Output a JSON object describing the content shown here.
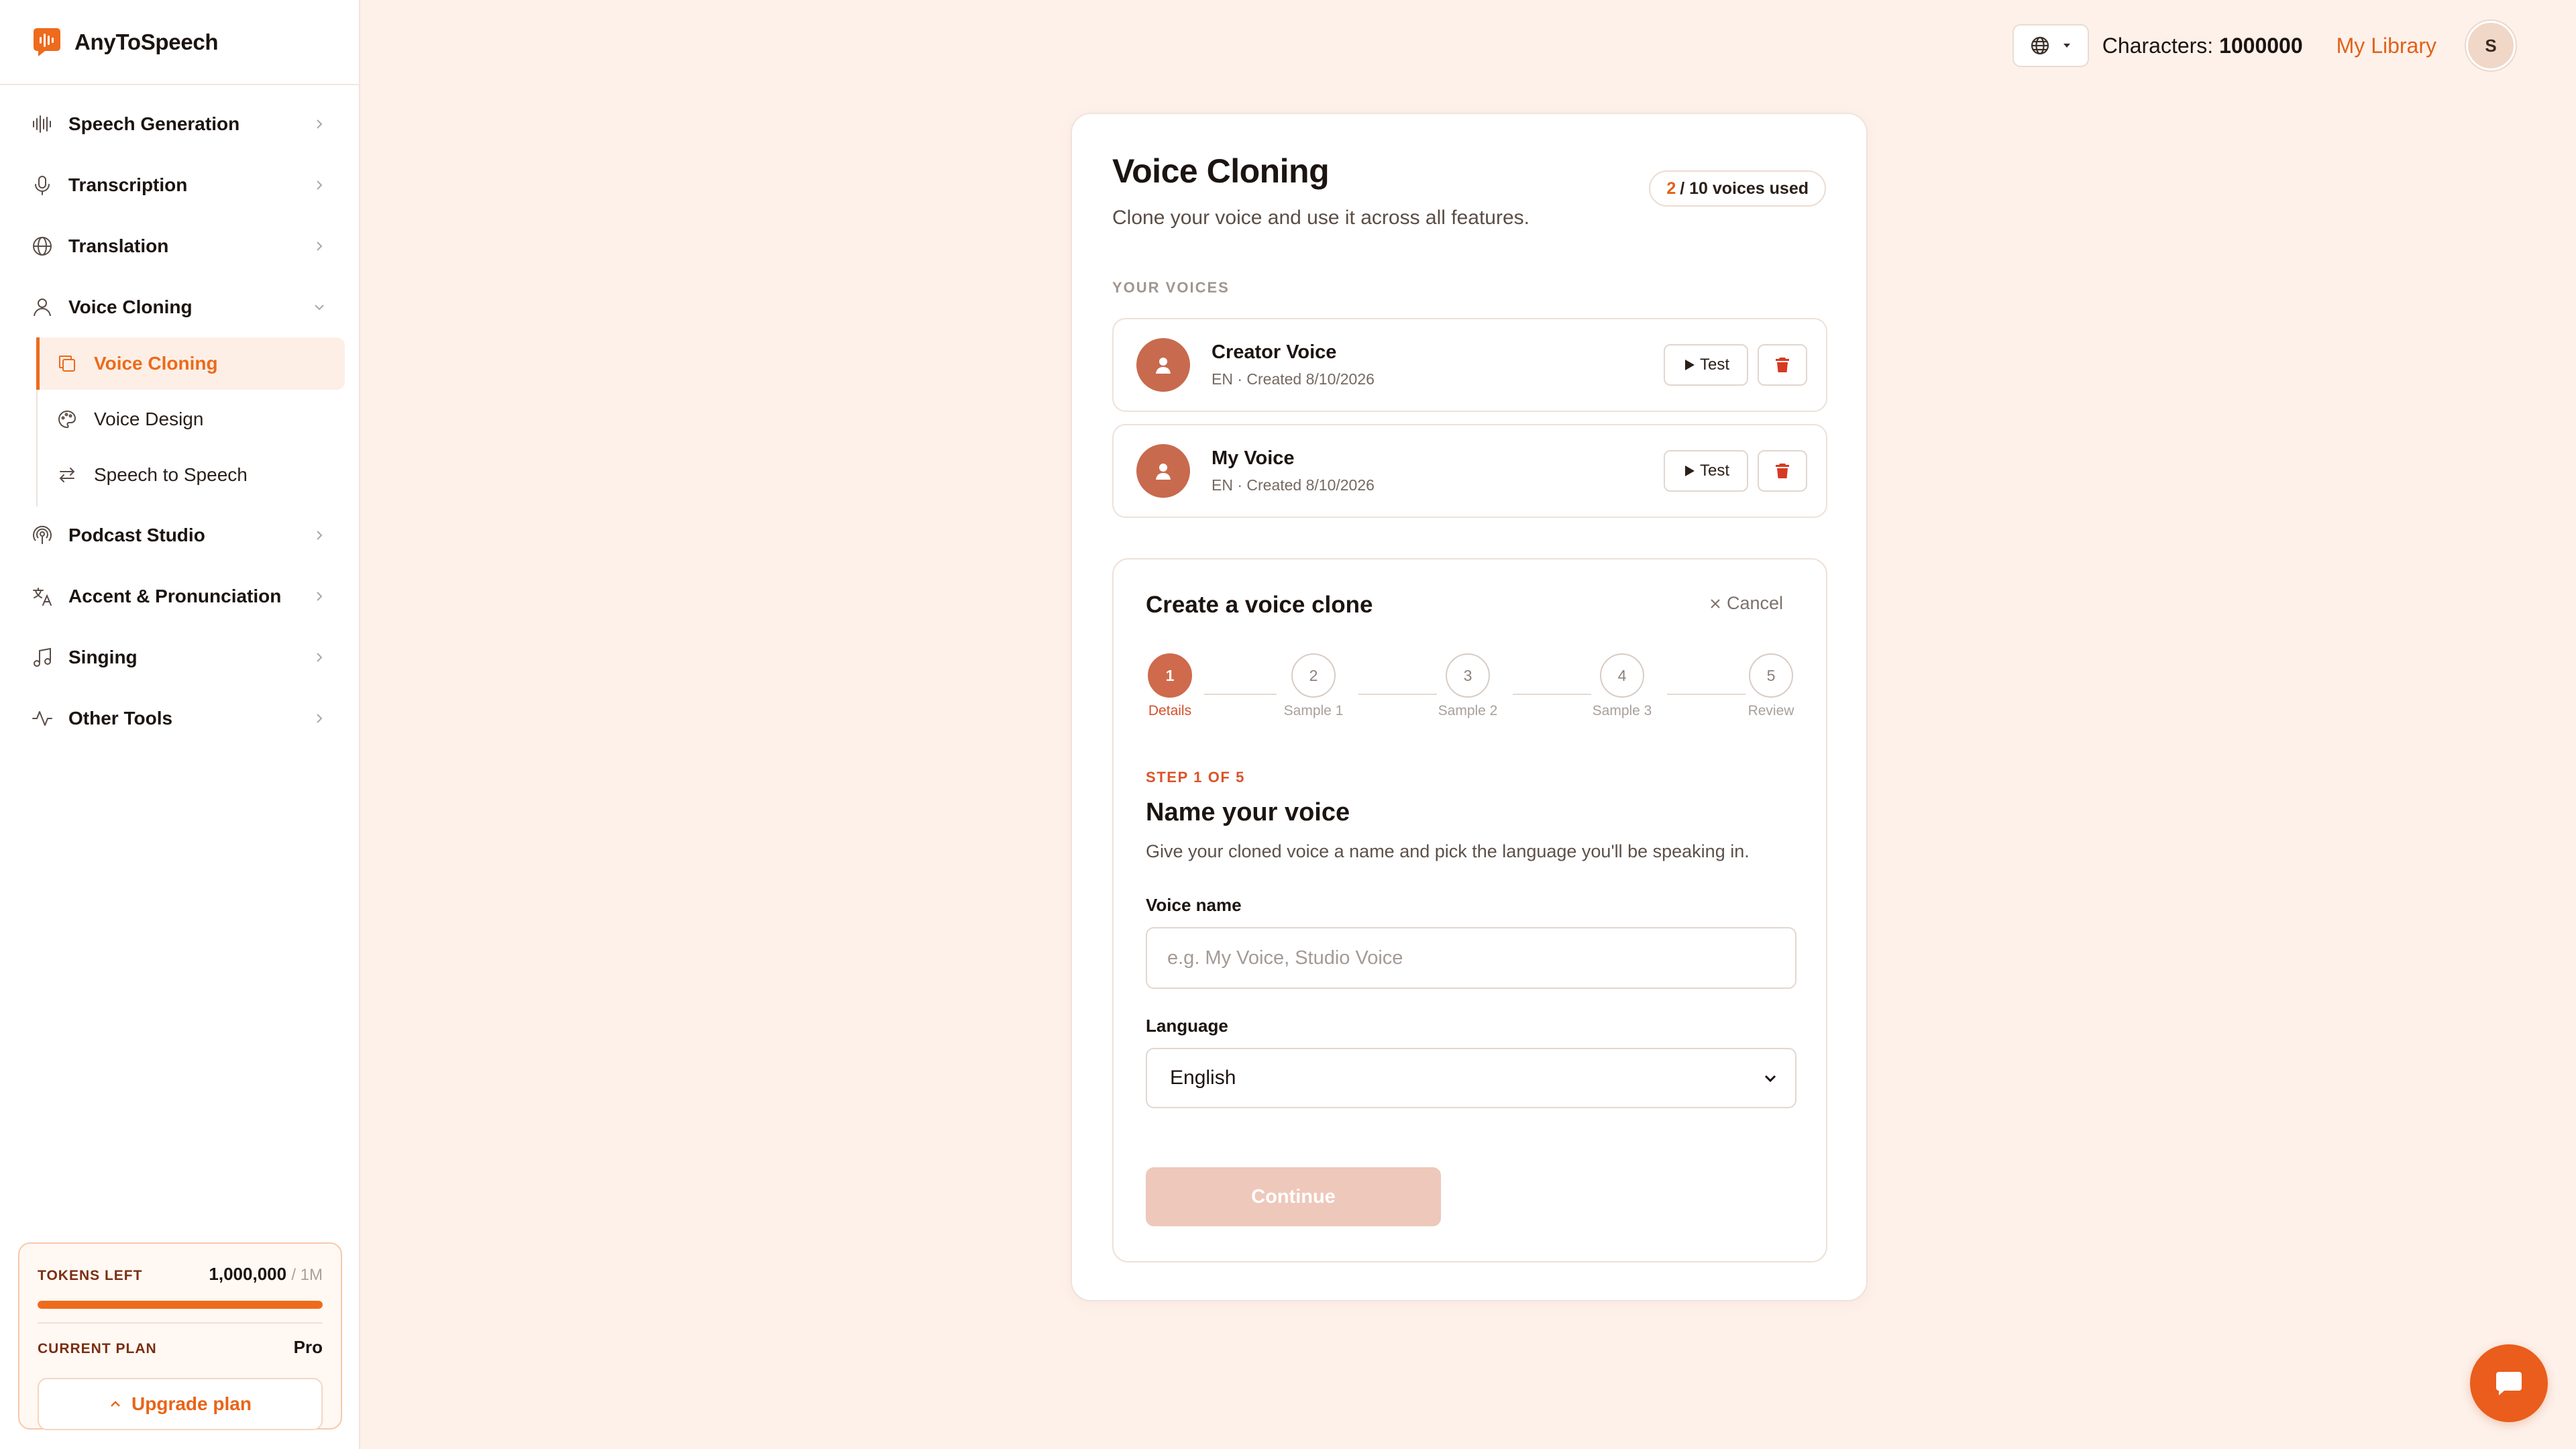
{
  "brand": {
    "name": "AnyToSpeech",
    "accent": "#ee6a1d"
  },
  "nav": {
    "items": [
      {
        "label": "Speech Generation",
        "icon": "waveform-icon"
      },
      {
        "label": "Transcription",
        "icon": "microphone-icon"
      },
      {
        "label": "Translation",
        "icon": "globe-icon"
      },
      {
        "label": "Voice Cloning",
        "icon": "user-icon",
        "expanded": true
      },
      {
        "label": "Podcast Studio",
        "icon": "podcast-icon"
      },
      {
        "label": "Accent & Pronunciation",
        "icon": "language-icon"
      },
      {
        "label": "Singing",
        "icon": "music-note-icon"
      },
      {
        "label": "Other Tools",
        "icon": "activity-icon"
      }
    ],
    "voice_cloning_sub": [
      {
        "label": "Voice Cloning",
        "icon": "copy-icon",
        "active": true
      },
      {
        "label": "Voice Design",
        "icon": "palette-icon"
      },
      {
        "label": "Speech to Speech",
        "icon": "swap-arrows-icon"
      }
    ]
  },
  "plan": {
    "tokens_label": "TOKENS LEFT",
    "tokens_value": "1,000,000",
    "tokens_total": "/ 1M",
    "tokens_fraction": 1.0,
    "current_plan_label": "CURRENT PLAN",
    "current_plan_value": "Pro",
    "upgrade_label": "Upgrade plan"
  },
  "topbar": {
    "characters_label": "Characters:",
    "characters_value": "1000000",
    "my_library": "My Library",
    "avatar_initial": "S"
  },
  "page": {
    "title": "Voice Cloning",
    "subtitle": "Clone your voice and use it across all features.",
    "usage_used": "2",
    "usage_rest": "/ 10 voices used",
    "your_voices_label": "YOUR VOICES"
  },
  "voices": [
    {
      "name": "Creator Voice",
      "meta": "EN · Created 8/10/2026",
      "test_label": "Test"
    },
    {
      "name": "My Voice",
      "meta": "EN · Created 8/10/2026",
      "test_label": "Test"
    }
  ],
  "clone": {
    "title": "Create a voice clone",
    "cancel_label": "Cancel",
    "steps": [
      {
        "number": "1",
        "label": "Details",
        "active": true
      },
      {
        "number": "2",
        "label": "Sample 1"
      },
      {
        "number": "3",
        "label": "Sample 2"
      },
      {
        "number": "4",
        "label": "Sample 3"
      },
      {
        "number": "5",
        "label": "Review"
      }
    ],
    "step_tag": "STEP 1 OF 5",
    "heading": "Name your voice",
    "description": "Give your cloned voice a name and pick the language you'll be speaking in.",
    "voice_name_label": "Voice name",
    "voice_name_placeholder": "e.g. My Voice, Studio Voice",
    "voice_name_value": "",
    "language_label": "Language",
    "language_value": "English",
    "continue_label": "Continue"
  }
}
